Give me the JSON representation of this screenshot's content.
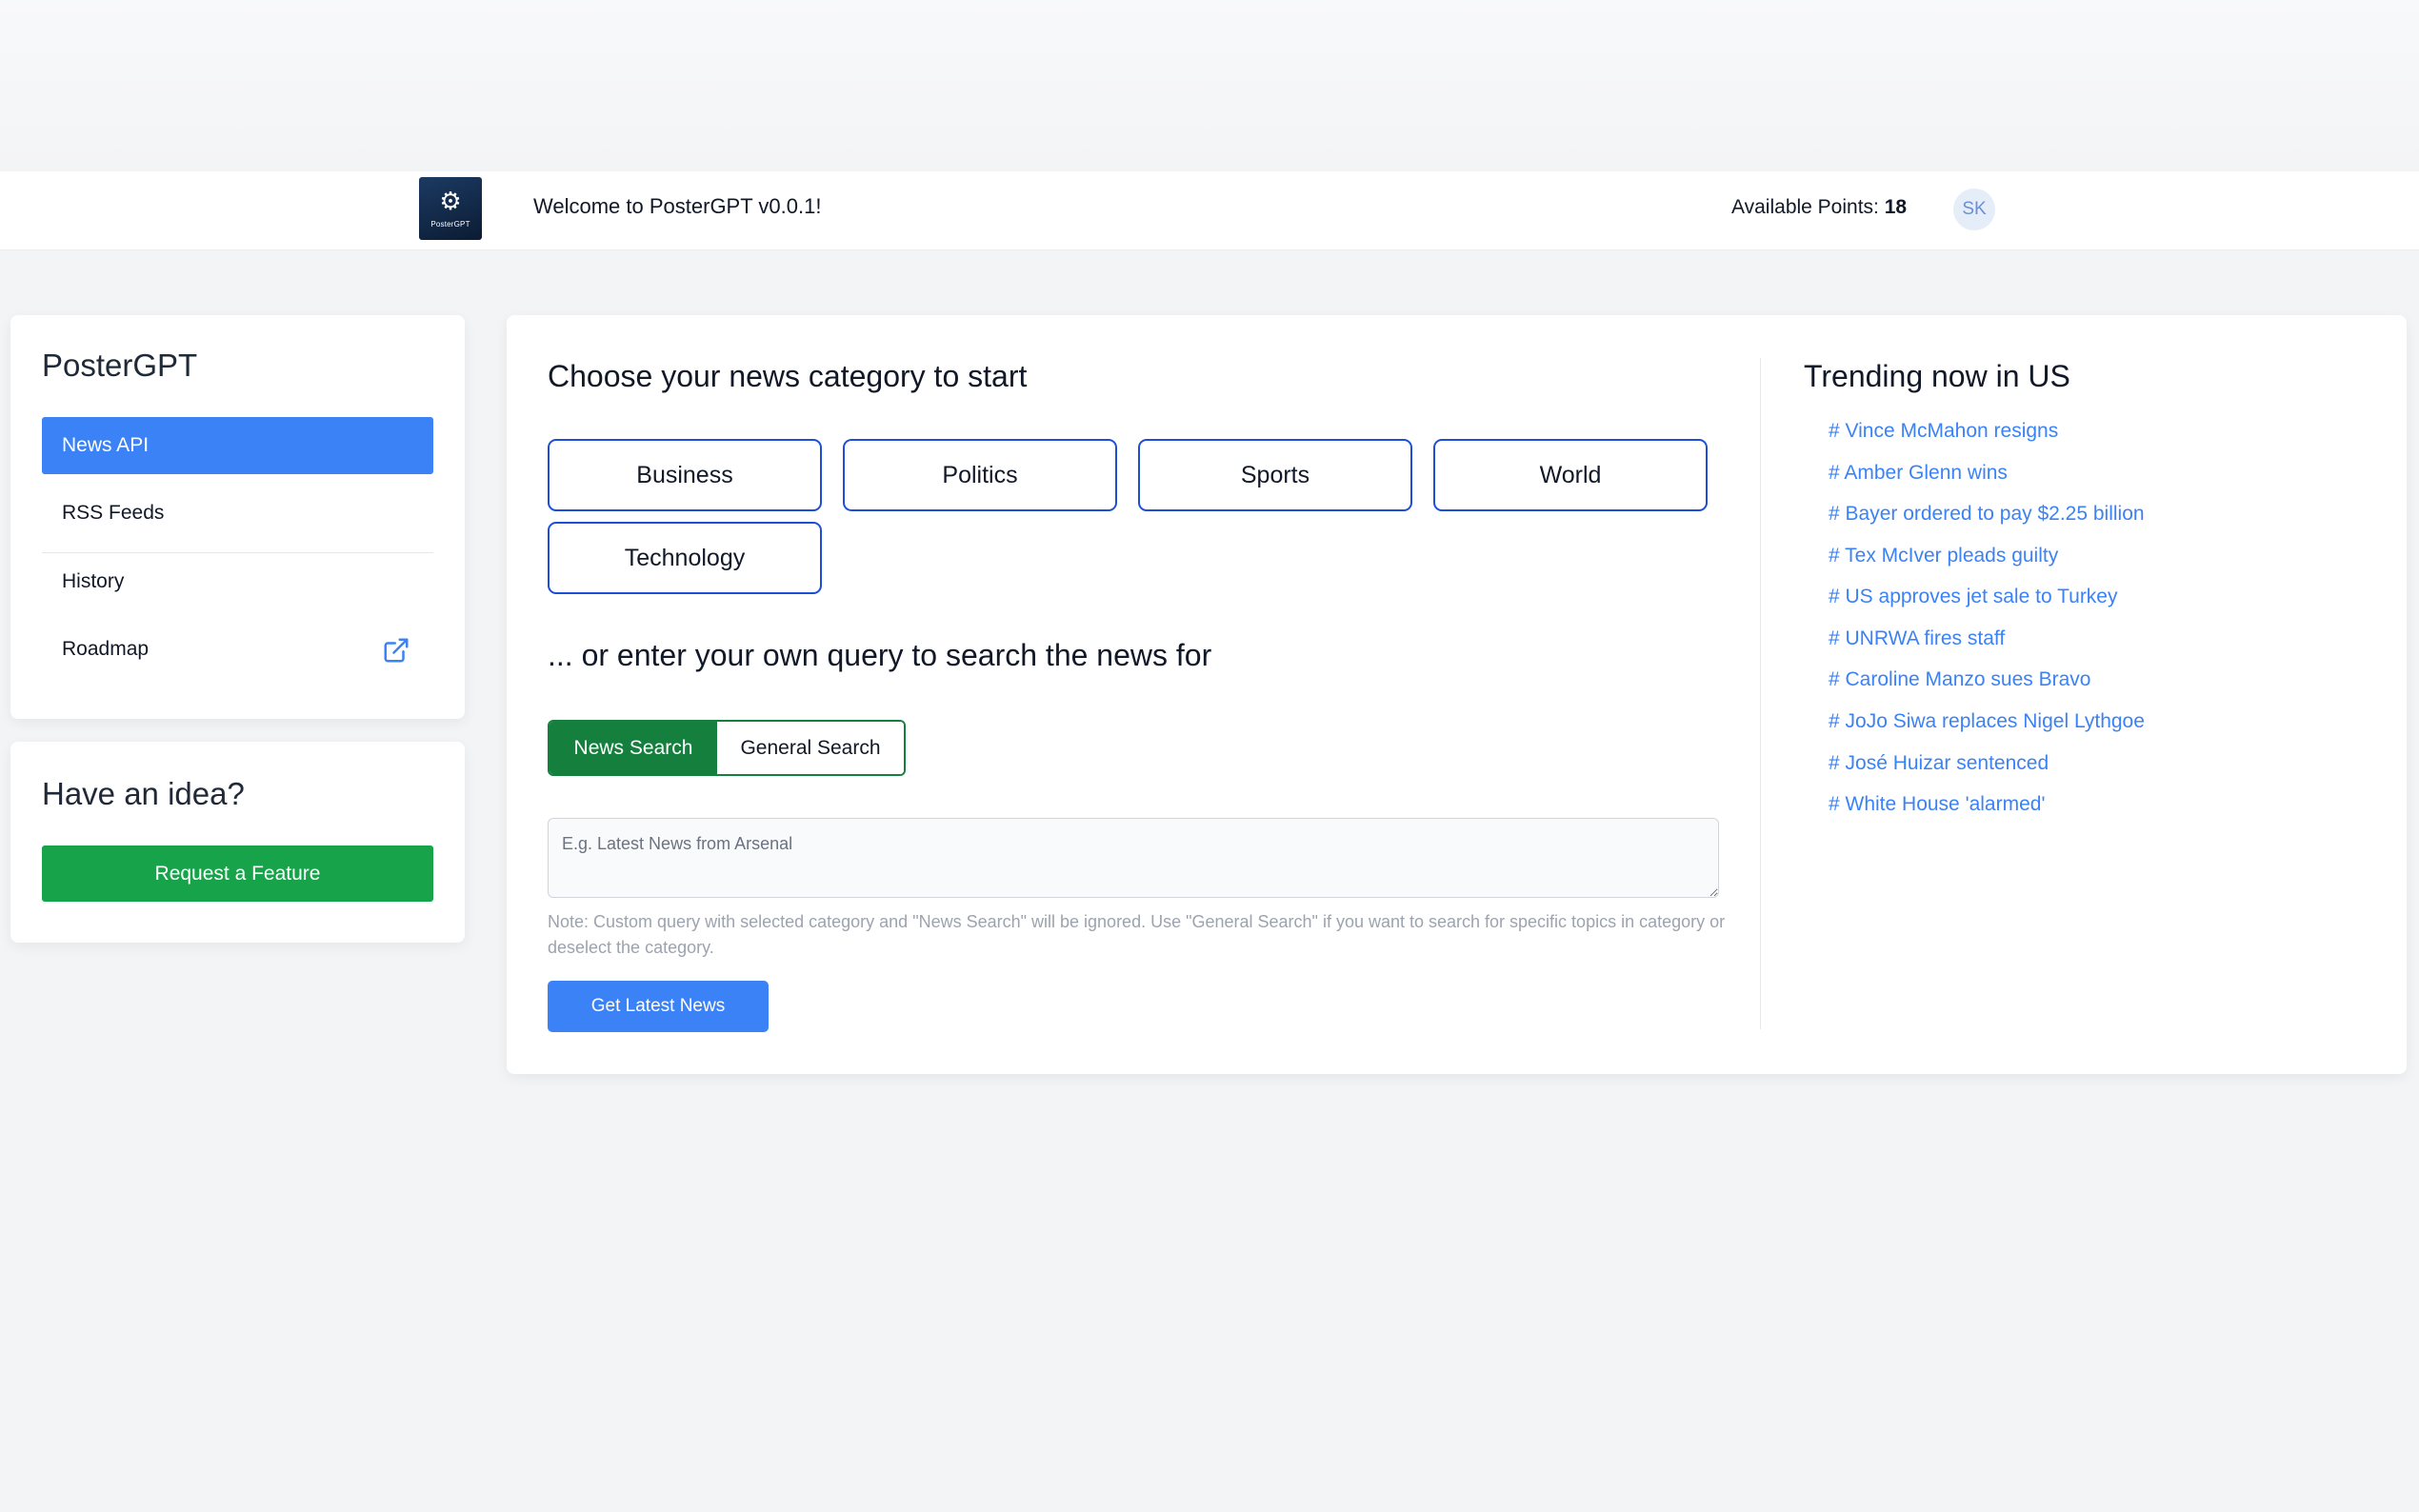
{
  "header": {
    "logo_caption": "PosterGPT",
    "welcome": "Welcome to PosterGPT v0.0.1!",
    "points_label": "Available Points:",
    "points_value": "18",
    "avatar_initials": "SK"
  },
  "sidebar": {
    "brand": "PosterGPT",
    "items": [
      {
        "label": "News API",
        "active": true
      },
      {
        "label": "RSS Feeds"
      },
      {
        "label": "History"
      },
      {
        "label": "Roadmap",
        "icon": "external-link-icon"
      }
    ]
  },
  "idea": {
    "title": "Have an idea?",
    "button": "Request a Feature"
  },
  "main": {
    "category_title": "Choose your news category to start",
    "categories": [
      "Business",
      "Politics",
      "Sports",
      "World",
      "Technology"
    ],
    "query_title": "... or enter your own query to search the news for",
    "search_modes": [
      "News Search",
      "General Search"
    ],
    "selected_mode": "News Search",
    "query_placeholder": "E.g. Latest News from Arsenal",
    "query_value": "",
    "note": "Note: Custom query with selected category and \"News Search\" will be ignored. Use \"General Search\" if you want to search for specific topics in category or deselect the category.",
    "submit": "Get Latest News"
  },
  "trending": {
    "title": "Trending now in US",
    "items": [
      "# Vince McMahon resigns",
      "# Amber Glenn wins",
      "# Bayer ordered to pay $2.25 billion",
      "# Tex McIver pleads guilty",
      "# US approves jet sale to Turkey",
      "# UNRWA fires staff",
      "# Caroline Manzo sues Bravo",
      "# JoJo Siwa replaces Nigel Lythgoe",
      "# José Huizar sentenced",
      "# White House 'alarmed'"
    ]
  },
  "colors": {
    "primary": "#3b82f6",
    "success": "#16a34a",
    "category_border": "#1d4ed8",
    "toggle_active": "#15803d"
  }
}
